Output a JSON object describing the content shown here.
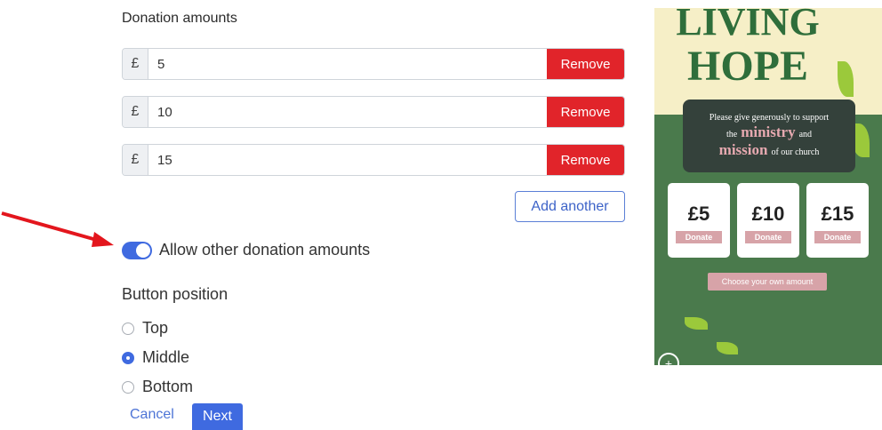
{
  "donation": {
    "title": "Donation amounts",
    "currency": "£",
    "amounts": [
      "5",
      "10",
      "15"
    ],
    "remove_label": "Remove",
    "add_another_label": "Add another"
  },
  "allow_other": {
    "label": "Allow other donation amounts",
    "enabled": true
  },
  "button_position": {
    "title": "Button position",
    "options": [
      "Top",
      "Middle",
      "Bottom"
    ],
    "selected": "Middle"
  },
  "actions": {
    "cancel_label": "Cancel",
    "next_label": "Next"
  },
  "poster": {
    "title_line1": "LIVING",
    "title_line2": "HOPE",
    "message_line1": "Please give generously to support",
    "message_the": "the",
    "message_ministry": "ministry",
    "message_and": "and",
    "message_mission": "mission",
    "message_end": "of our church",
    "cards": [
      {
        "amount": "£5",
        "button": "Donate"
      },
      {
        "amount": "£10",
        "button": "Donate"
      },
      {
        "amount": "£15",
        "button": "Donate"
      }
    ],
    "own_amount_label": "Choose your own amount"
  },
  "colors": {
    "primary": "#3f6ae0",
    "remove": "#e1242a",
    "poster_green": "#4a7a4c",
    "arrow": "#e3161d"
  }
}
